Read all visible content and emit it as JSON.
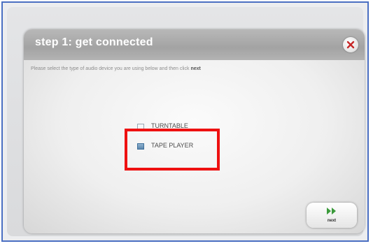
{
  "dialog": {
    "title": "step 1: get connected",
    "instruction": "Please select the type of audio device you are using below and then click",
    "instruction_emphasis": "next",
    "options": [
      {
        "label": "TURNTABLE",
        "checked": false
      },
      {
        "label": "TAPE PLAYER",
        "checked": true
      }
    ],
    "next_label": "next"
  },
  "icons": {
    "close": "close-icon",
    "next": "fast-forward-icon"
  },
  "colors": {
    "highlight": "#ee1111",
    "close_x": "#c62828",
    "next_arrow": "#3a9a3a",
    "frame_border": "#4a6fc2"
  }
}
